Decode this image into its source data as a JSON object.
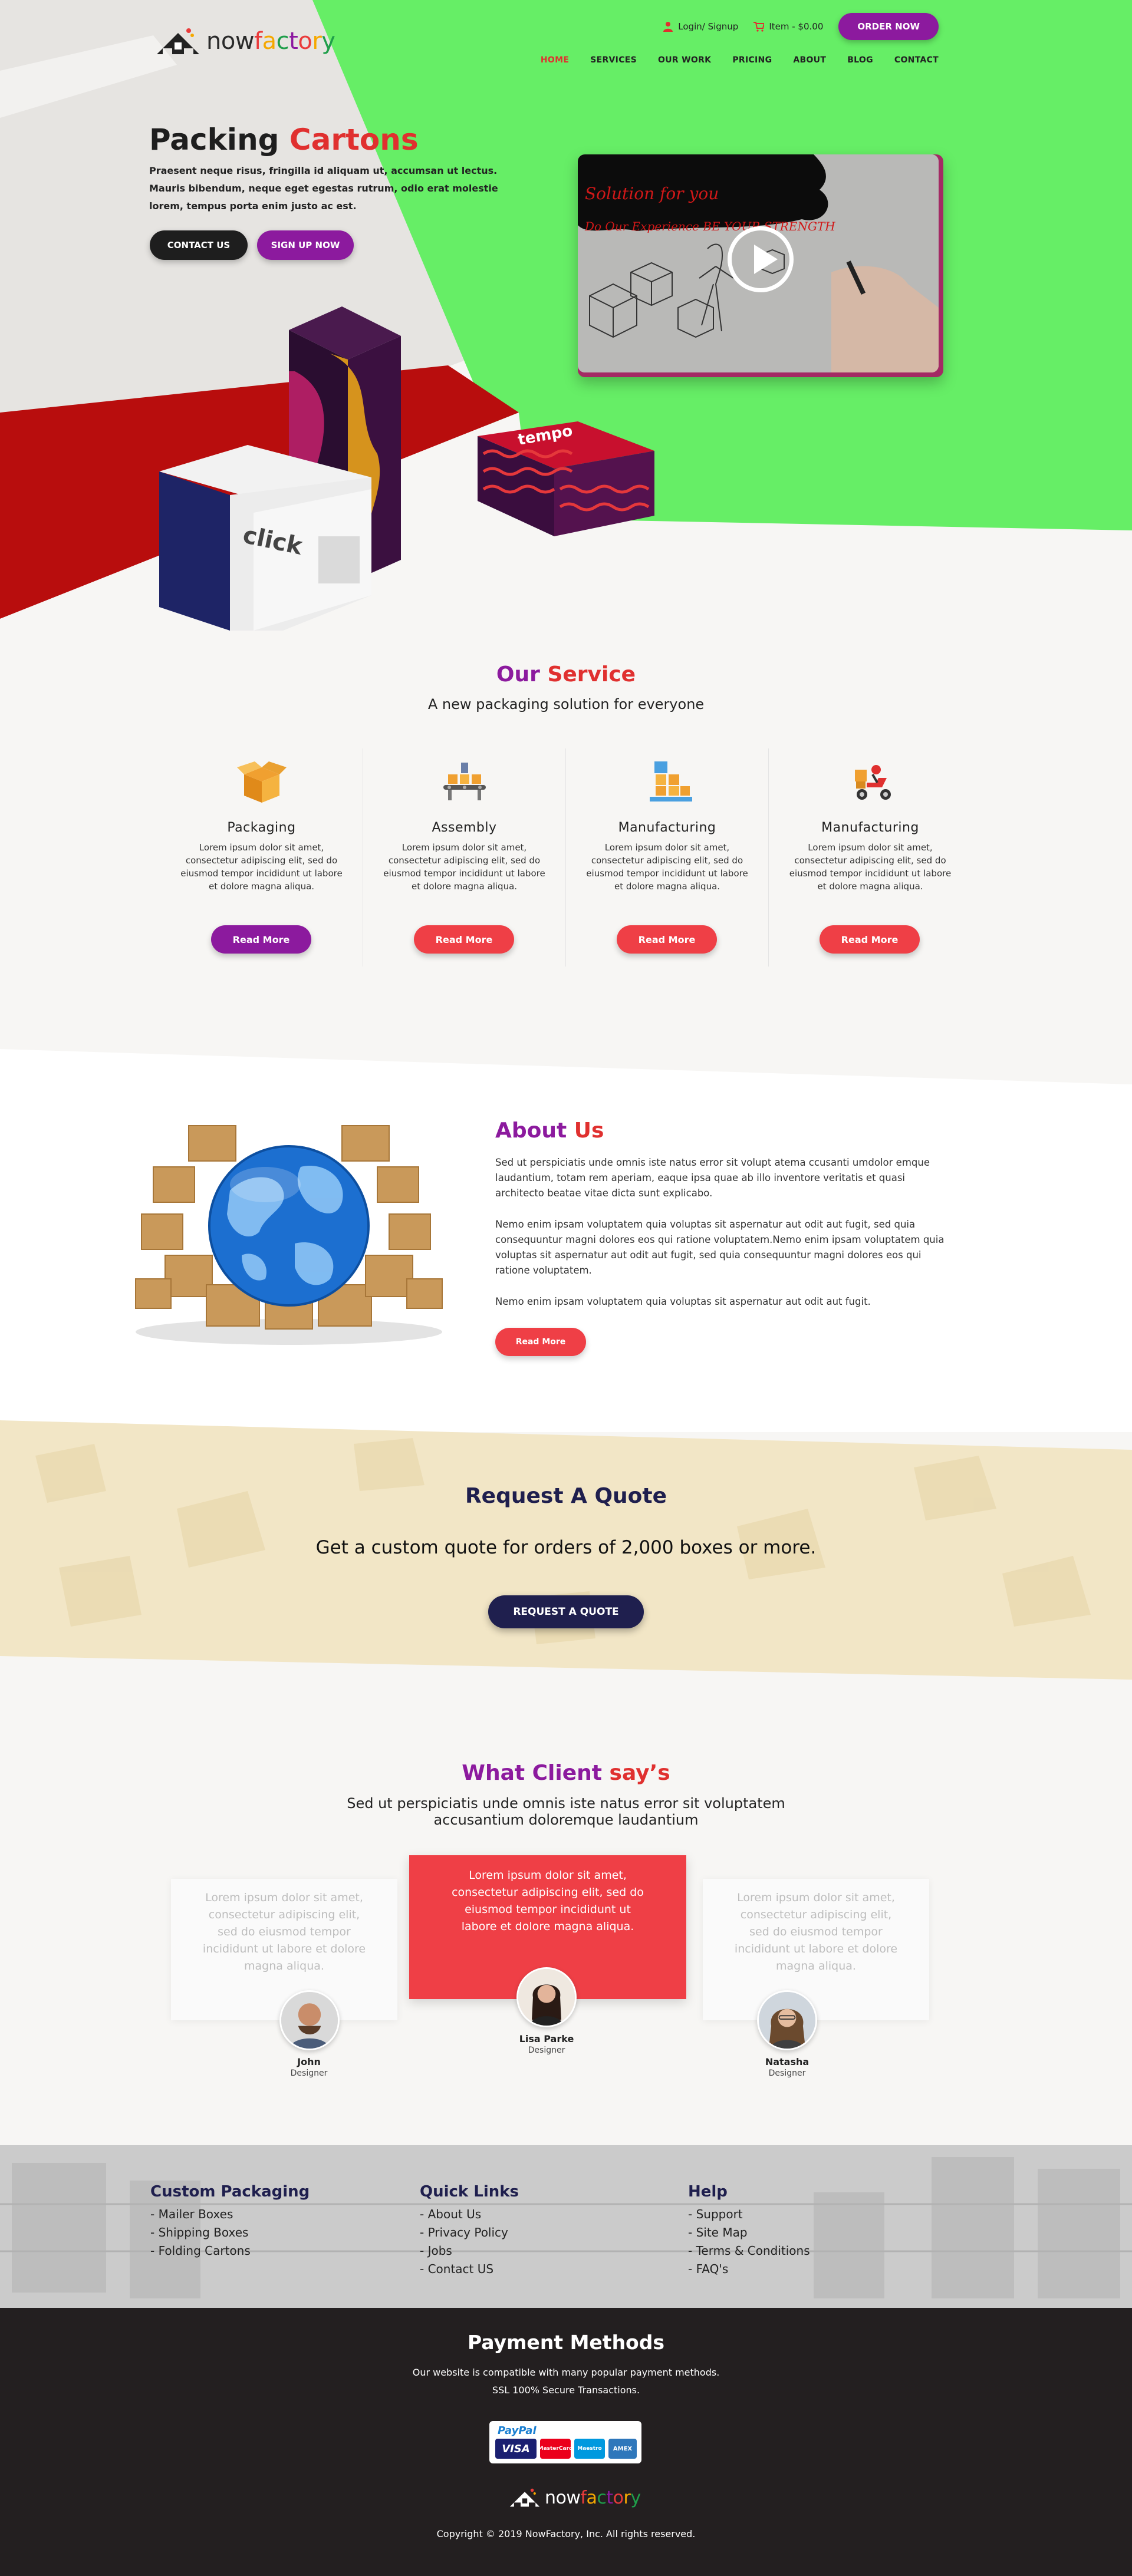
{
  "header": {
    "logo_parts": [
      "now",
      "f",
      "a",
      "c",
      "t",
      "o",
      "r",
      "y"
    ],
    "login_label": "Login/ Signup",
    "cart_label": "Item - $0.00",
    "order_label": "ORDER NOW",
    "nav": [
      "HOME",
      "SERVICES",
      "OUR WORK",
      "PRICING",
      "ABOUT",
      "BLOG",
      "CONTACT"
    ]
  },
  "hero": {
    "title_a": "Packing",
    "title_b": "Cartons",
    "text": "Praesent neque risus, fringilla id aliquam ut, accumsan ut lectus. Mauris bibendum, neque eget egestas rutrum, odio erat molestie lorem, tempus porta enim justo ac est.",
    "contact_btn": "CONTACT US",
    "signup_btn": "SIGN UP NOW",
    "video_line1": "Solution for you",
    "video_line2": "Do Our Experience BE YOUR STRENGTH",
    "box_label_click": "click",
    "box_label_tempo": "tempo"
  },
  "service": {
    "title_a": "Our",
    "title_b": "Service",
    "subtitle": "A new packaging solution for everyone",
    "items": [
      {
        "title": "Packaging",
        "desc": "Lorem ipsum dolor sit amet, consectetur adipiscing elit, sed do eiusmod tempor incididunt ut labore et dolore magna aliqua.",
        "button": "Read More",
        "icon": "open-box-icon"
      },
      {
        "title": "Assembly",
        "desc": "Lorem ipsum dolor sit amet, consectetur adipiscing elit, sed do eiusmod tempor incididunt ut labore et dolore magna aliqua.",
        "button": "Read More",
        "icon": "conveyor-icon"
      },
      {
        "title": "Manufacturing",
        "desc": "Lorem ipsum dolor sit amet, consectetur adipiscing elit, sed do eiusmod tempor incididunt ut labore et dolore magna aliqua.",
        "button": "Read More",
        "icon": "boxes-stack-icon"
      },
      {
        "title": "Manufacturing",
        "desc": "Lorem ipsum dolor sit amet, consectetur adipiscing elit, sed do eiusmod tempor incididunt ut labore et dolore magna aliqua.",
        "button": "Read More",
        "icon": "delivery-scooter-icon"
      }
    ]
  },
  "about": {
    "title_a": "About",
    "title_b": "Us",
    "p1": "Sed ut perspiciatis unde omnis iste natus error sit volupt atema ccusanti umdolor emque laudantium, totam rem aperiam, eaque ipsa quae ab illo inventore veritatis et quasi architecto beatae vitae dicta sunt explicabo.",
    "p2": "Nemo enim ipsam voluptatem quia voluptas sit aspernatur aut odit aut fugit, sed quia consequuntur magni dolores eos qui ratione voluptatem.Nemo enim ipsam voluptatem quia voluptas sit aspernatur aut odit aut fugit, sed quia consequuntur magni dolores eos qui ratione voluptatem.",
    "p3": "Nemo enim ipsam voluptatem quia voluptas sit aspernatur aut odit aut fugit.",
    "button": "Read More"
  },
  "quote": {
    "title": "Request A Quote",
    "subtitle": "Get a custom quote for orders of 2,000 boxes or more.",
    "button": "REQUEST A QUOTE"
  },
  "testimonials": {
    "title_a": "What Client",
    "title_b": "say’s",
    "subtitle_line1": "Sed ut perspiciatis unde omnis iste natus error sit voluptatem",
    "subtitle_line2": "accusantium doloremque laudantium",
    "items": [
      {
        "text": "Lorem ipsum dolor sit amet, consectetur adipiscing elit, sed do eiusmod tempor incididunt ut labore et dolore magna aliqua.",
        "name": "John",
        "role": "Designer"
      },
      {
        "text": "Lorem ipsum dolor sit amet, consectetur adipiscing elit, sed do eiusmod tempor incididunt ut labore et dolore magna aliqua.",
        "name": "Lisa Parke",
        "role": "Designer"
      },
      {
        "text": "Lorem ipsum dolor sit amet, consectetur adipiscing elit, sed do eiusmod tempor incididunt ut labore et dolore magna aliqua.",
        "name": "Natasha",
        "role": "Designer"
      }
    ]
  },
  "footer_links": {
    "columns": [
      {
        "title": "Custom Packaging",
        "items": [
          "- Mailer Boxes",
          "- Shipping Boxes",
          "- Folding Cartons"
        ]
      },
      {
        "title": "Quick Links",
        "items": [
          "- About Us",
          "- Privacy Policy",
          "- Jobs",
          "- Contact US"
        ]
      },
      {
        "title": "Help",
        "items": [
          "- Support",
          "- Site Map",
          "- Terms & Conditions",
          "- FAQ's"
        ]
      }
    ]
  },
  "payment": {
    "title": "Payment Methods",
    "line1": "Our website is compatible with many popular payment methods.",
    "line2": "SSL 100% Secure Transactions.",
    "paypal": "PayPal",
    "cards": [
      "VISA",
      "MasterCard",
      "Maestro",
      "AMEX"
    ],
    "copyright": "Copyright © 2019 NowFactory, Inc. All rights reserved."
  },
  "colors": {
    "purple": "#8c1a9e",
    "red": "#e0302f",
    "green": "#66ee66",
    "navy": "#1f1f4e",
    "dark": "#231f20"
  }
}
